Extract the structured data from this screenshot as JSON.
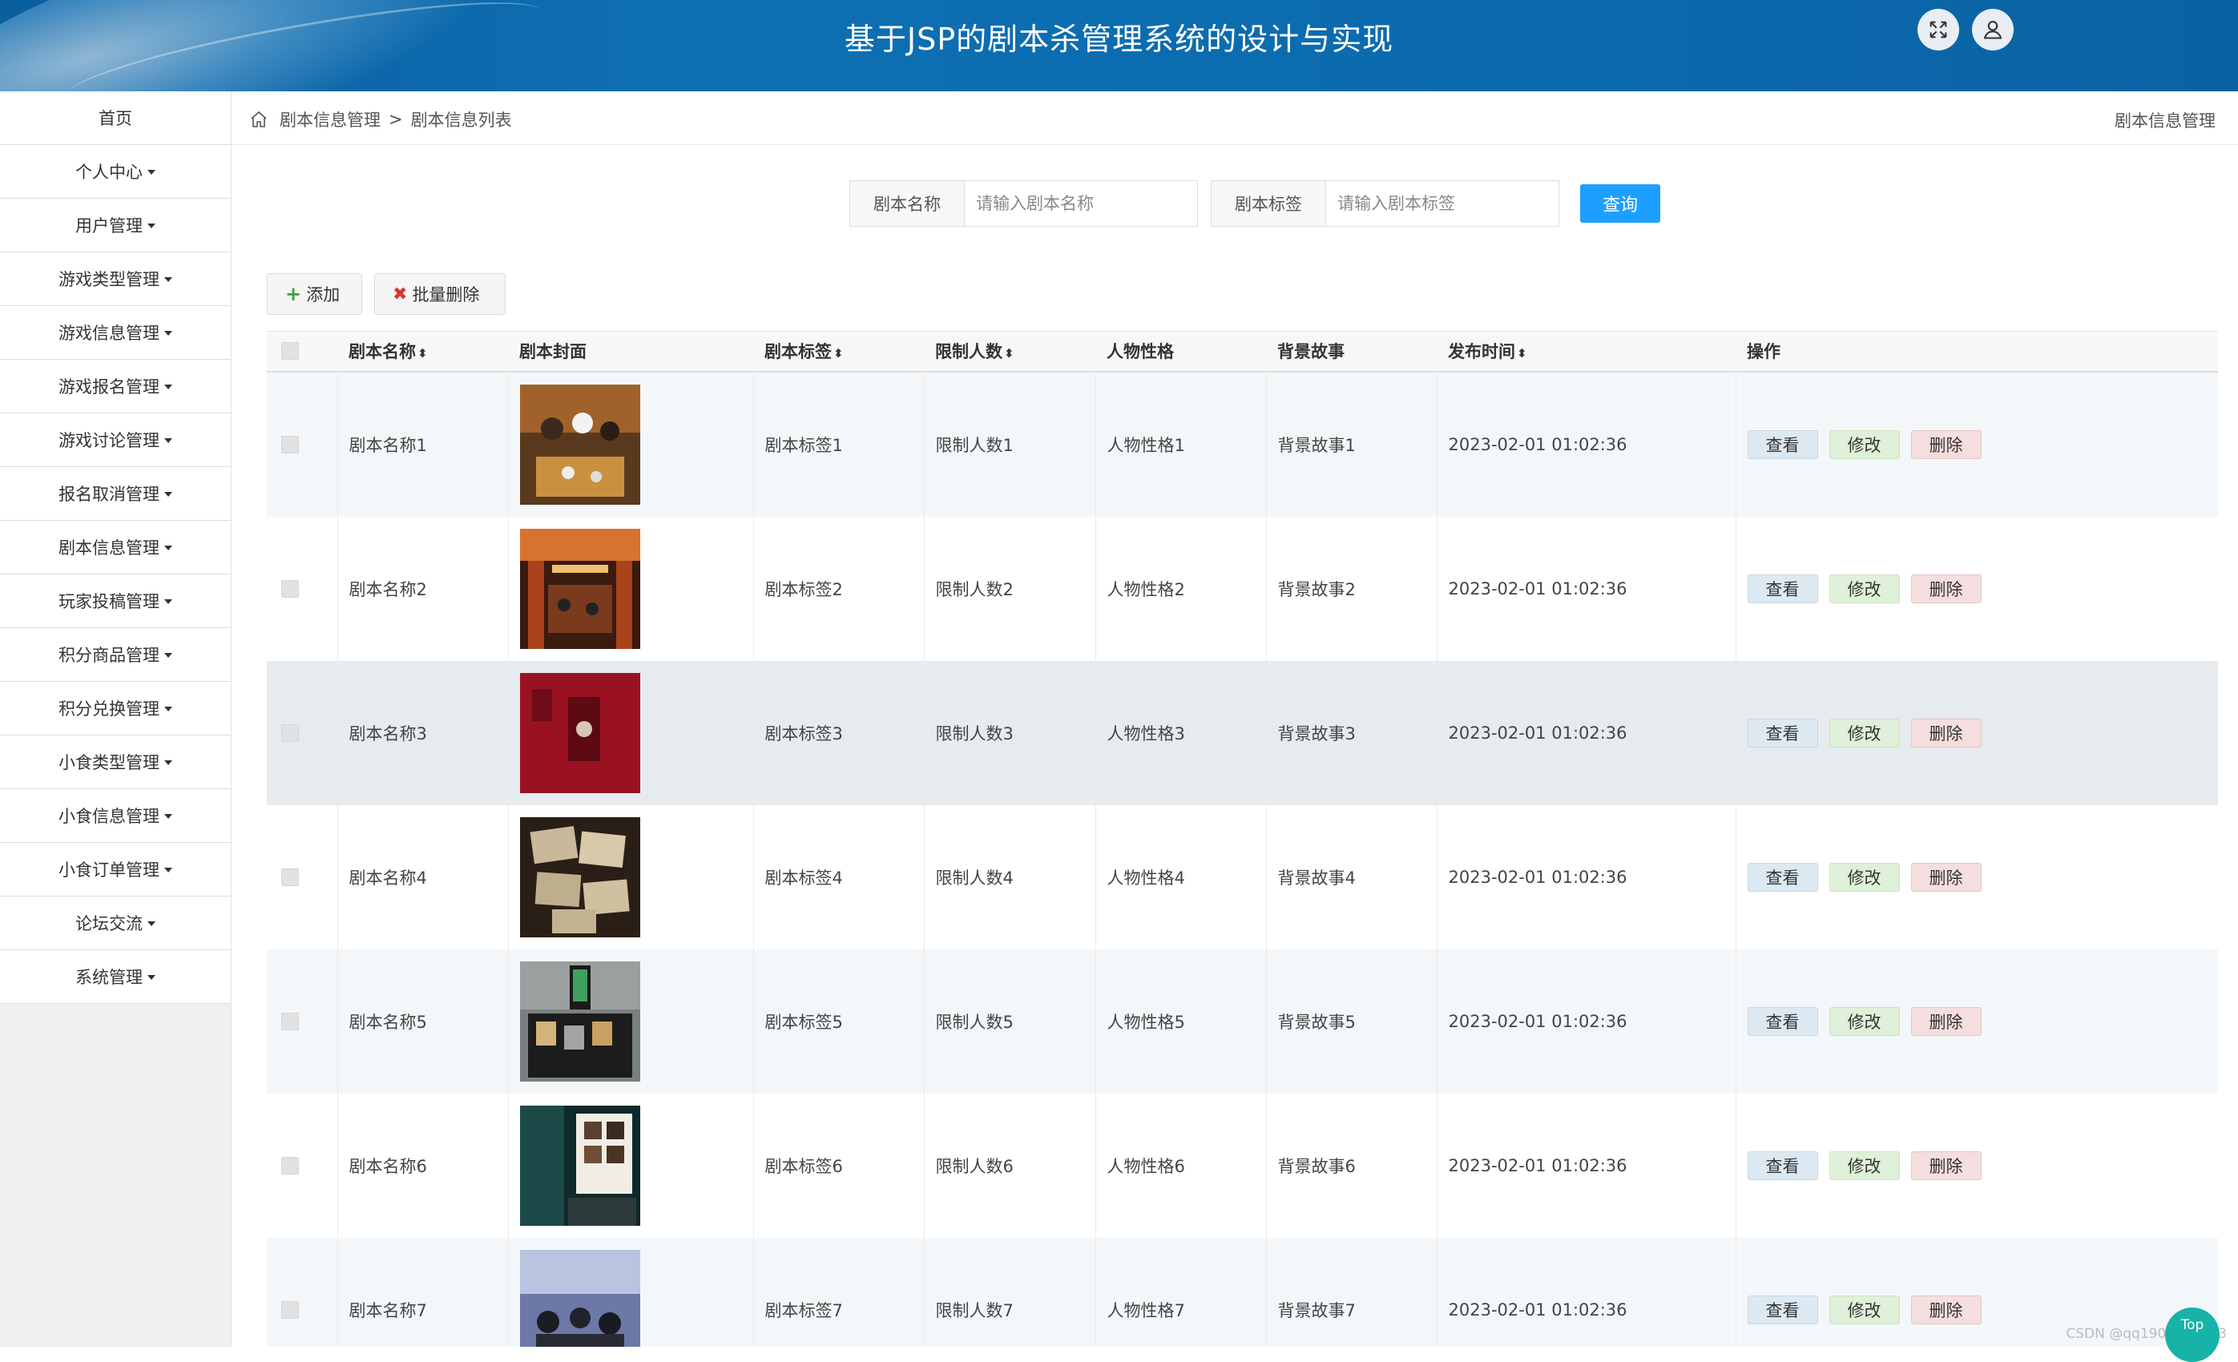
{
  "header": {
    "title": "基于JSP的剧本杀管理系统的设计与实现"
  },
  "sidebar": {
    "items": [
      {
        "label": "首页",
        "dropdown": false
      },
      {
        "label": "个人中心",
        "dropdown": true
      },
      {
        "label": "用户管理",
        "dropdown": true
      },
      {
        "label": "游戏类型管理",
        "dropdown": true
      },
      {
        "label": "游戏信息管理",
        "dropdown": true
      },
      {
        "label": "游戏报名管理",
        "dropdown": true
      },
      {
        "label": "游戏讨论管理",
        "dropdown": true
      },
      {
        "label": "报名取消管理",
        "dropdown": true
      },
      {
        "label": "剧本信息管理",
        "dropdown": true
      },
      {
        "label": "玩家投稿管理",
        "dropdown": true
      },
      {
        "label": "积分商品管理",
        "dropdown": true
      },
      {
        "label": "积分兑换管理",
        "dropdown": true
      },
      {
        "label": "小食类型管理",
        "dropdown": true
      },
      {
        "label": "小食信息管理",
        "dropdown": true
      },
      {
        "label": "小食订单管理",
        "dropdown": true
      },
      {
        "label": "论坛交流",
        "dropdown": true
      },
      {
        "label": "系统管理",
        "dropdown": true
      }
    ]
  },
  "breadcrumb": {
    "parent": "剧本信息管理",
    "separator": ">",
    "current": "剧本信息列表"
  },
  "topbar_right": "剧本信息管理",
  "search": {
    "name_label": "剧本名称",
    "name_placeholder": "请输入剧本名称",
    "name_value": "",
    "tag_label": "剧本标签",
    "tag_placeholder": "请输入剧本标签",
    "tag_value": "",
    "button": "查询"
  },
  "toolbar": {
    "add": "添加",
    "batch_delete": "批量删除"
  },
  "table": {
    "headers": {
      "name": "剧本名称",
      "cover": "剧本封面",
      "tag": "剧本标签",
      "limit": "限制人数",
      "personality": "人物性格",
      "background": "背景故事",
      "time": "发布时间",
      "actions": "操作"
    },
    "actions": {
      "view": "查看",
      "edit": "修改",
      "delete": "删除"
    },
    "hovered_row": 2,
    "rows": [
      {
        "name": "剧本名称1",
        "tag": "剧本标签1",
        "limit": "限制人数1",
        "personality": "人物性格1",
        "background": "背景故事1",
        "time": "2023-02-01 01:02:36"
      },
      {
        "name": "剧本名称2",
        "tag": "剧本标签2",
        "limit": "限制人数2",
        "personality": "人物性格2",
        "background": "背景故事2",
        "time": "2023-02-01 01:02:36"
      },
      {
        "name": "剧本名称3",
        "tag": "剧本标签3",
        "limit": "限制人数3",
        "personality": "人物性格3",
        "background": "背景故事3",
        "time": "2023-02-01 01:02:36"
      },
      {
        "name": "剧本名称4",
        "tag": "剧本标签4",
        "limit": "限制人数4",
        "personality": "人物性格4",
        "background": "背景故事4",
        "time": "2023-02-01 01:02:36"
      },
      {
        "name": "剧本名称5",
        "tag": "剧本标签5",
        "limit": "限制人数5",
        "personality": "人物性格5",
        "background": "背景故事5",
        "time": "2023-02-01 01:02:36"
      },
      {
        "name": "剧本名称6",
        "tag": "剧本标签6",
        "limit": "限制人数6",
        "personality": "人物性格6",
        "background": "背景故事6",
        "time": "2023-02-01 01:02:36"
      },
      {
        "name": "剧本名称7",
        "tag": "剧本标签7",
        "limit": "限制人数7",
        "personality": "人物性格7",
        "background": "背景故事7",
        "time": "2023-02-01 01:02:36"
      }
    ]
  },
  "watermark": "CSDN @qq1900255523",
  "top_button": "Top",
  "icons": {
    "fullscreen": "fullscreen-icon",
    "user": "user-icon",
    "home": "home-icon",
    "add": "plus-icon",
    "batch_delete": "x-icon",
    "sort": "sort-icon",
    "dropdown": "caret-down-icon"
  }
}
